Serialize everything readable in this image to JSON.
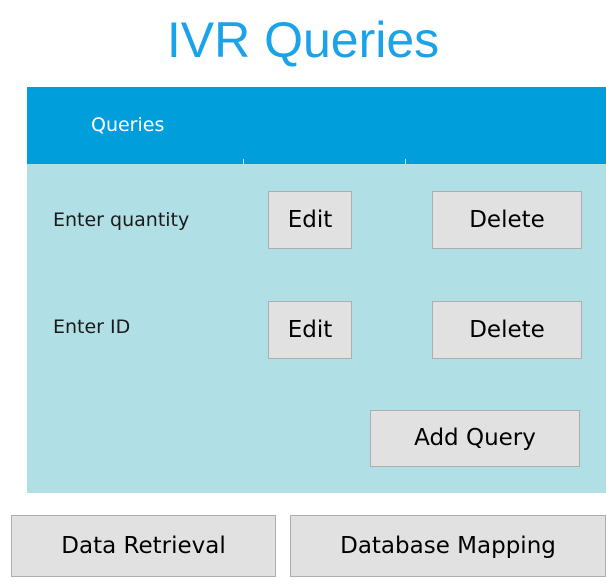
{
  "title": "IVR Queries",
  "panel": {
    "header": "Queries",
    "queries": [
      {
        "label": "Enter quantity",
        "edit_label": "Edit",
        "delete_label": "Delete"
      },
      {
        "label": "Enter ID",
        "edit_label": "Edit",
        "delete_label": "Delete"
      }
    ],
    "add_query_label": "Add Query"
  },
  "footer": {
    "data_retrieval_label": "Data Retrieval",
    "database_mapping_label": "Database Mapping"
  },
  "colors": {
    "title": "#1aa3e8",
    "header_background": "#009fdc",
    "panel_background": "#b0dfe6",
    "button_background": "#e1e1e1"
  }
}
